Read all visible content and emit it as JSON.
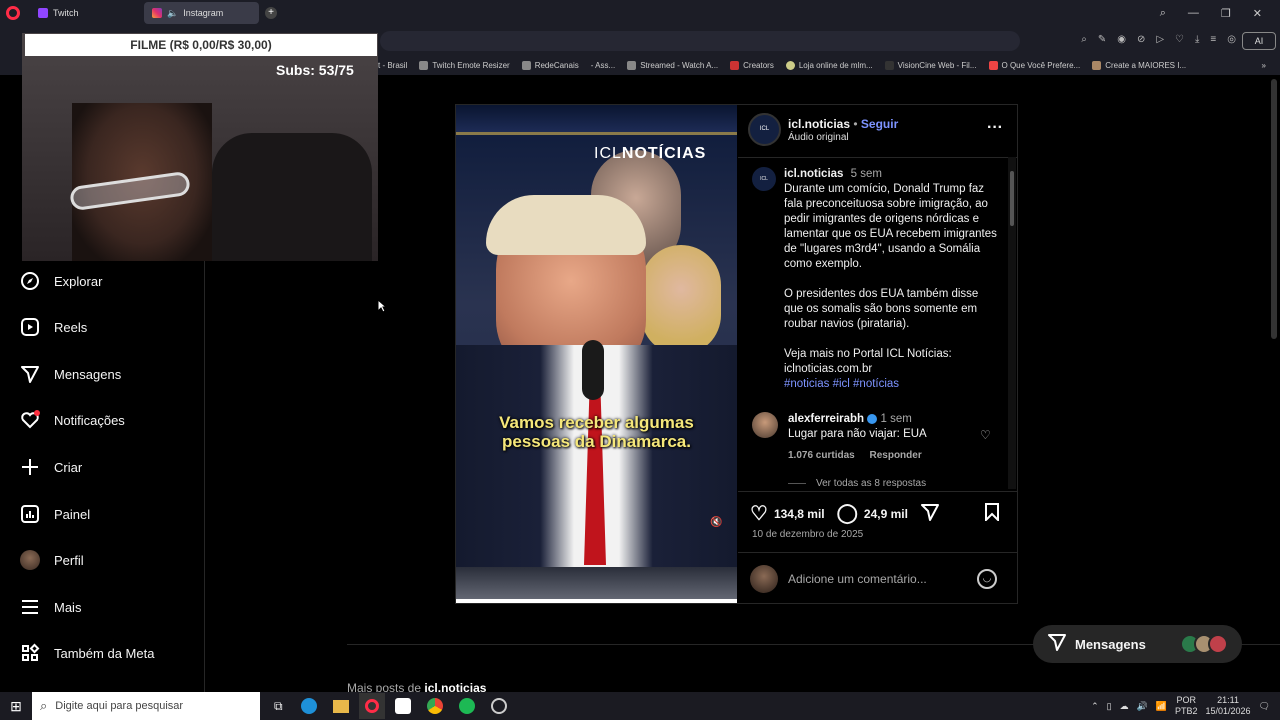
{
  "browser": {
    "tabs": [
      {
        "label": "Twitch"
      },
      {
        "label": "Instagram"
      }
    ],
    "bookmarks": [
      "t - Brasil",
      "Twitch Emote Resizer",
      "RedeCanais",
      "- Ass...",
      "Streamed - Watch A...",
      "Creators",
      "Loja online de mlm...",
      "VisionCine Web - Fil...",
      "O Que Você Prefere...",
      "Create a MAIORES I..."
    ],
    "ai_label": "AI"
  },
  "stream_overlay": {
    "title": "FILME (R$ 0,00/R$ 30,00)",
    "subs": "Subs: 53/75"
  },
  "sidebar": {
    "items": [
      {
        "label": "Explorar"
      },
      {
        "label": "Reels"
      },
      {
        "label": "Mensagens"
      },
      {
        "label": "Notificações"
      },
      {
        "label": "Criar"
      },
      {
        "label": "Painel"
      },
      {
        "label": "Perfil"
      },
      {
        "label": "Mais"
      },
      {
        "label": "Também da Meta"
      }
    ]
  },
  "video": {
    "brand_light": "ICL",
    "brand_bold": "NOTÍCIAS",
    "subtitle_line1": "Vamos receber algumas",
    "subtitle_line2": "pessoas da Dinamarca."
  },
  "post": {
    "username": "icl.noticias",
    "follow": "Seguir",
    "audio": "Áudio original",
    "caption_user": "icl.noticias",
    "caption_age": "5 sem",
    "caption_p1": "Durante um comício, Donald Trump faz fala preconceituosa sobre imigração, ao pedir imigrantes de origens nórdicas e lamentar que os EUA recebem imigrantes de \"lugares m3rd4\", usando a Somália como exemplo.",
    "caption_p2": "O presidentes dos EUA também disse que os somalis são bons somente em roubar navios (pirataria).",
    "caption_p3_line1": "Veja mais no Portal ICL Notícias:",
    "caption_p3_line2": "iclnoticias.com.br",
    "hashtags": "#noticias #icl #notícias",
    "comment": {
      "user": "alexferreirabh",
      "age": "1 sem",
      "text": "Lugar para não viajar: EUA",
      "likes": "1.076 curtidas",
      "reply": "Responder",
      "view_replies": "Ver todas as 8 respostas"
    },
    "likes": "134,8 mil",
    "comments": "24,9 mil",
    "date": "10 de dezembro de 2025",
    "add_comment": "Adicione um comentário..."
  },
  "more_posts": {
    "prefix": "Mais posts de",
    "user": "icl.noticias"
  },
  "messages_button": {
    "label": "Mensagens"
  },
  "taskbar": {
    "search": "Digite aqui para pesquisar",
    "lang1": "POR",
    "lang2": "PTB2",
    "time": "21:11",
    "date": "15/01/2026"
  }
}
